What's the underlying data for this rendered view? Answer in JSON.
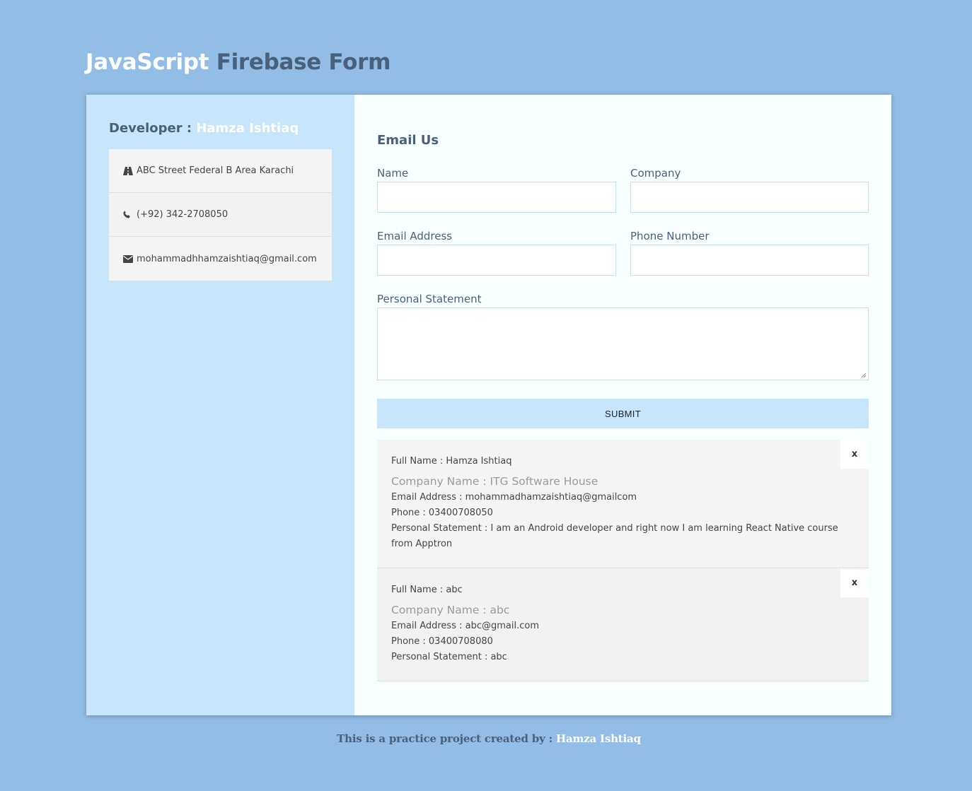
{
  "header": {
    "title_part1": "JavaScript",
    "title_part2": "Firebase Form"
  },
  "sidebar": {
    "developer_label": "Developer :",
    "developer_name": "Hamza Ishtiaq",
    "contacts": [
      {
        "icon": "road-icon",
        "text": "ABC Street Federal B Area Karachi"
      },
      {
        "icon": "phone-icon",
        "text": "(+92) 342-2708050"
      },
      {
        "icon": "envelope-icon",
        "text": "mohammadhhamzaishtiaq@gmail.com"
      }
    ]
  },
  "form": {
    "heading": "Email Us",
    "name_label": "Name",
    "name_value": "",
    "company_label": "Company",
    "company_value": "",
    "email_label": "Email Address",
    "email_value": "",
    "phone_label": "Phone Number",
    "phone_value": "",
    "statement_label": "Personal Statement",
    "statement_value": "",
    "submit_label": "SUBMIT"
  },
  "entries": [
    {
      "full_name": "Full Name : Hamza Ishtiaq",
      "company": "Company Name : ITG Software House",
      "email": "Email Address : mohammadhamzaishtiaq@gmailcom",
      "phone": "Phone : 03400708050",
      "statement": "Personal Statement : I am an Android developer and right now I am learning React Native course from Apptron",
      "delete_label": "x"
    },
    {
      "full_name": "Full Name : abc",
      "company": "Company Name : abc",
      "email": "Email Address : abc@gmail.com",
      "phone": "Phone : 03400708080",
      "statement": "Personal Statement : abc",
      "delete_label": "x"
    }
  ],
  "footer": {
    "text": "This is a practice project created by :",
    "name": "Hamza Ishtiaq"
  },
  "colors": {
    "page_bg": "#92bde6",
    "left_panel": "#c7e5fb",
    "right_panel": "#f8ffff",
    "accent_text": "#48607a"
  }
}
